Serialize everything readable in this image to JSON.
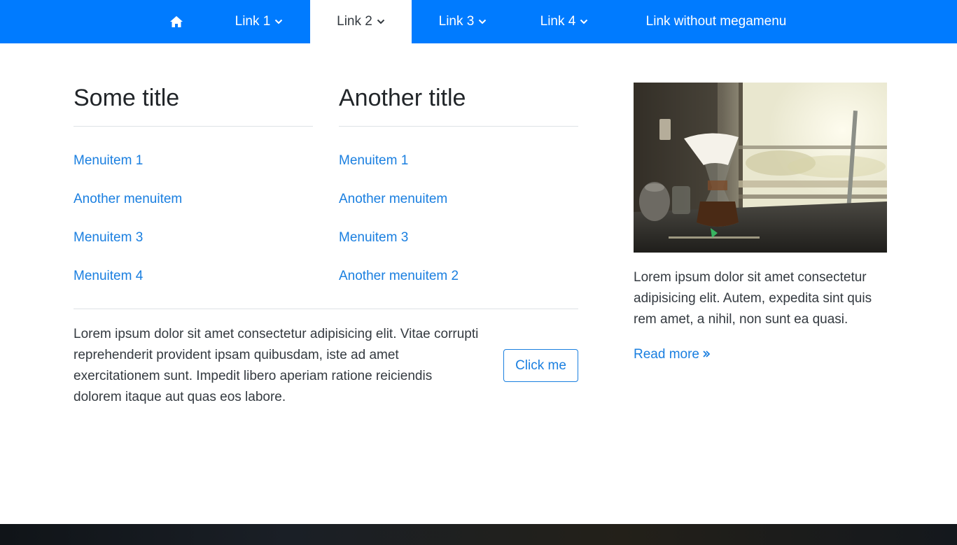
{
  "navbar": {
    "background": "#007bff",
    "items": [
      {
        "label": "",
        "icon": "home-icon"
      },
      {
        "label": "Link 1",
        "icon": "chevron-down-icon"
      },
      {
        "label": "Link 2",
        "icon": "chevron-down-icon",
        "active": true
      },
      {
        "label": "Link 3",
        "icon": "chevron-down-icon"
      },
      {
        "label": "Link 4",
        "icon": "chevron-down-icon"
      },
      {
        "label": "Link without megamenu"
      }
    ]
  },
  "megamenu": {
    "columns": [
      {
        "title": "Some title",
        "items": [
          "Menuitem 1",
          "Another menuitem",
          "Menuitem 3",
          "Menuitem 4"
        ]
      },
      {
        "title": "Another title",
        "items": [
          "Menuitem 1",
          "Another menuitem",
          "Menuitem 3",
          "Another menuitem 2"
        ]
      }
    ],
    "bottom_text": "Lorem ipsum dolor sit amet consectetur adipisicing elit. Vitae corrupti reprehenderit provident ipsam quibusdam, iste ad amet exercitationem sunt. Impedit libero aperiam ratione reiciendis dolorem itaque aut quas eos labore.",
    "button_label": "Click me",
    "sidebar": {
      "image": "coffee-pour-over-photo",
      "text": "Lorem ipsum dolor sit amet consectetur adipisicing elit. Autem, expedita sint quis rem amet, a nihil, non sunt ea quasi.",
      "read_more_label": "Read more"
    }
  },
  "colors": {
    "primary": "#007bff",
    "link": "#1a7fe0",
    "divider": "#dee2e6"
  }
}
